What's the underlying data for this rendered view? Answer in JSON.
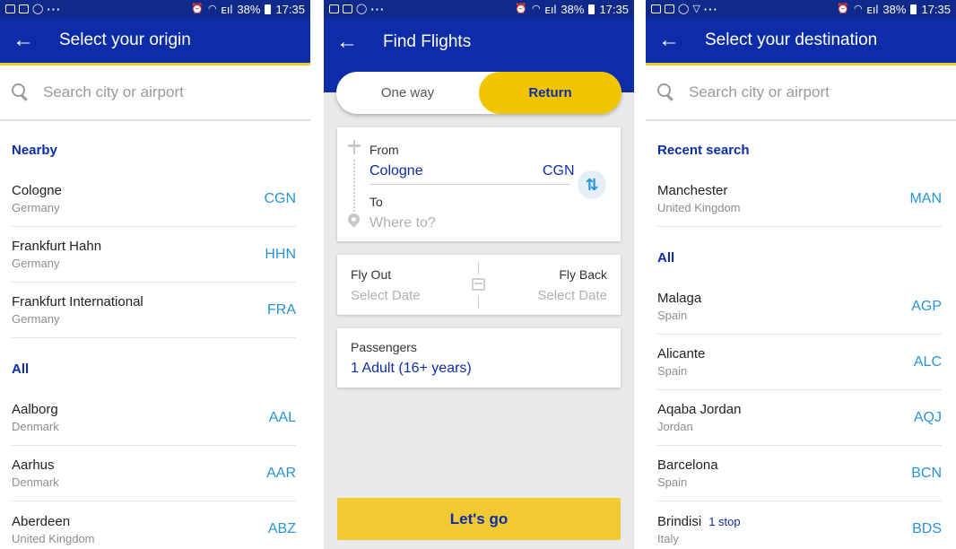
{
  "status": {
    "battery": "38%",
    "time": "17:35",
    "signal": "ᴇıl"
  },
  "origin": {
    "title": "Select your origin",
    "search_placeholder": "Search city or airport",
    "sections": [
      {
        "label": "Nearby",
        "items": [
          {
            "name": "Cologne",
            "country": "Germany",
            "code": "CGN"
          },
          {
            "name": "Frankfurt Hahn",
            "country": "Germany",
            "code": "HHN"
          },
          {
            "name": "Frankfurt International",
            "country": "Germany",
            "code": "FRA"
          }
        ]
      },
      {
        "label": "All",
        "items": [
          {
            "name": "Aalborg",
            "country": "Denmark",
            "code": "AAL"
          },
          {
            "name": "Aarhus",
            "country": "Denmark",
            "code": "AAR"
          },
          {
            "name": "Aberdeen",
            "country": "United Kingdom",
            "code": "ABZ"
          }
        ]
      }
    ]
  },
  "find": {
    "title": "Find Flights",
    "trip_one_way": "One way",
    "trip_return": "Return",
    "from_label": "From",
    "from_city": "Cologne",
    "from_code": "CGN",
    "to_label": "To",
    "to_placeholder": "Where to?",
    "fly_out_label": "Fly Out",
    "fly_out_value": "Select Date",
    "fly_back_label": "Fly Back",
    "fly_back_value": "Select Date",
    "passengers_label": "Passengers",
    "passengers_value": "1 Adult (16+ years)",
    "go_label": "Let's go",
    "swap_glyph": "⇅"
  },
  "destination": {
    "title": "Select your destination",
    "search_placeholder": "Search city or airport",
    "sections": [
      {
        "label": "Recent search",
        "items": [
          {
            "name": "Manchester",
            "country": "United Kingdom",
            "code": "MAN"
          }
        ]
      },
      {
        "label": "All",
        "items": [
          {
            "name": "Malaga",
            "country": "Spain",
            "code": "AGP"
          },
          {
            "name": "Alicante",
            "country": "Spain",
            "code": "ALC"
          },
          {
            "name": "Aqaba Jordan",
            "country": "Jordan",
            "code": "AQJ"
          },
          {
            "name": "Barcelona",
            "country": "Spain",
            "code": "BCN"
          },
          {
            "name": "Brindisi",
            "country": "Italy",
            "code": "BDS",
            "note": "1 stop"
          }
        ]
      }
    ]
  },
  "colors": {
    "brand_blue": "#0d2da8",
    "accent_yellow": "#f1c933",
    "code_blue": "#2893d6"
  }
}
